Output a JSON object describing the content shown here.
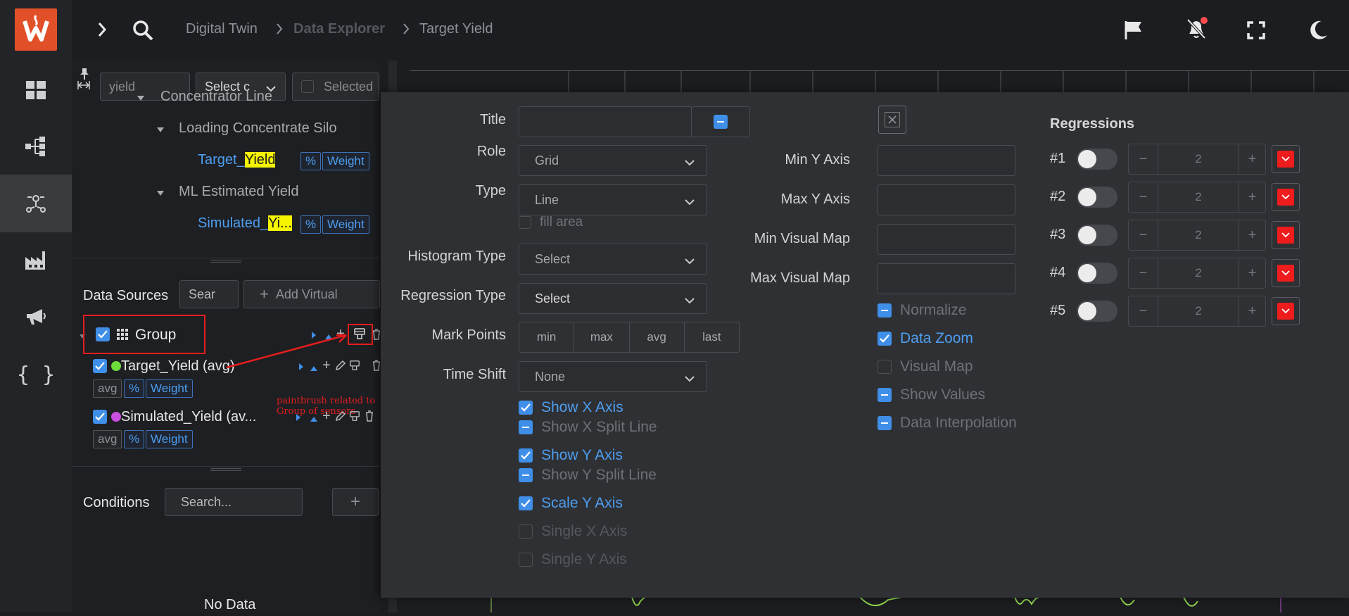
{
  "topbar": {
    "crumbs": [
      "Digital Twin",
      "Data Explorer",
      "Target Yield"
    ]
  },
  "nav": {
    "items": [
      "dashboard-icon",
      "flow-icon",
      "sensor-network-icon",
      "factory-icon",
      "megaphone-icon",
      "code-braces-icon"
    ]
  },
  "tree_panel": {
    "search_value": "yield",
    "select_label": "Select c",
    "selected_label": "Selected",
    "nodes": {
      "concentrator": "Concentrator Line",
      "silo": "Loading Concentrate Silo",
      "target_prefix": "Target_",
      "target_hl": "Yield",
      "ml": "ML Estimated Yield",
      "sim_prefix": "Simulated_",
      "sim_hl": "Yi...",
      "pct": "%",
      "weight": "Weight"
    },
    "data_sources": {
      "label": "Data Sources",
      "search": "Sear",
      "add_virtual": "Add Virtual",
      "group_label": "Group",
      "items": [
        {
          "name": "Target_Yield (avg)",
          "color": "#6ddc3b",
          "agg": "avg",
          "pct": "%",
          "unit": "Weight"
        },
        {
          "name": "Simulated_Yield (av...",
          "color": "#c94fe0",
          "agg": "avg",
          "pct": "%",
          "unit": "Weight"
        }
      ],
      "annotation": "paintbrush related to Group of sensors"
    },
    "conditions": {
      "label": "Conditions",
      "search_placeholder": "Search...",
      "add": "+",
      "empty": "No Data"
    }
  },
  "modal": {
    "labels": {
      "title": "Title",
      "role": "Role",
      "type": "Type",
      "fill_area": "fill area",
      "histogram": "Histogram Type",
      "regression": "Regression Type",
      "mark_points": "Mark Points",
      "time_shift": "Time Shift",
      "min_y": "Min Y Axis",
      "max_y": "Max Y Axis",
      "min_vm": "Min Visual Map",
      "max_vm": "Max Visual Map",
      "regressions": "Regressions"
    },
    "values": {
      "role": "Grid",
      "type": "Line",
      "histogram": "Select",
      "regression": "Select",
      "time_shift": "None"
    },
    "mark_points": [
      "min",
      "max",
      "avg",
      "last"
    ],
    "left_checks": [
      {
        "label": "Show X Axis",
        "state": "on"
      },
      {
        "label": "Show X Split Line",
        "state": "indeterminate"
      },
      {
        "label": "Show Y Axis",
        "state": "on"
      },
      {
        "label": "Show Y Split Line",
        "state": "indeterminate"
      },
      {
        "label": "Scale Y Axis",
        "state": "on"
      },
      {
        "label": "Single X Axis",
        "state": "off"
      },
      {
        "label": "Single Y Axis",
        "state": "off"
      }
    ],
    "right_checks": [
      {
        "label": "Normalize",
        "state": "indeterminate"
      },
      {
        "label": "Data Zoom",
        "state": "on"
      },
      {
        "label": "Visual Map",
        "state": "off"
      },
      {
        "label": "Show Values",
        "state": "indeterminate"
      },
      {
        "label": "Data Interpolation",
        "state": "indeterminate"
      }
    ],
    "regressions": [
      {
        "id": "#1",
        "value": "2",
        "minus": "−",
        "plus": "+"
      },
      {
        "id": "#2",
        "value": "2",
        "minus": "−",
        "plus": "+"
      },
      {
        "id": "#3",
        "value": "2",
        "minus": "−",
        "plus": "+"
      },
      {
        "id": "#4",
        "value": "2",
        "minus": "−",
        "plus": "+"
      },
      {
        "id": "#5",
        "value": "2",
        "minus": "−",
        "plus": "+"
      }
    ],
    "accent_color": "#4d9ef0",
    "danger_color": "#ee1c1c"
  }
}
